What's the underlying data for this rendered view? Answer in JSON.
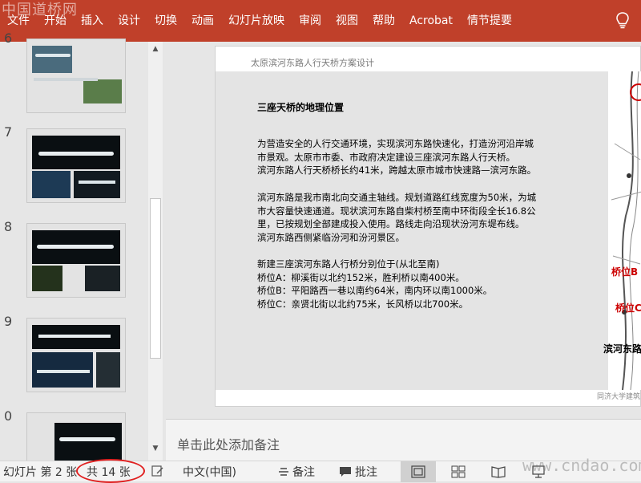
{
  "watermark_top": "中国道桥网",
  "watermark_bottom": "www.cndao.com",
  "ribbon": {
    "tabs": [
      "文件",
      "开始",
      "插入",
      "设计",
      "切换",
      "动画",
      "幻灯片放映",
      "审阅",
      "视图",
      "帮助",
      "Acrobat",
      "情节提要"
    ],
    "tell_me_icon": "lightbulb-icon"
  },
  "thumbnails": {
    "numbers": [
      "6",
      "7",
      "8",
      "9",
      "0"
    ]
  },
  "slide": {
    "header": "太原滨河东路人行天桥方案设计",
    "title": "三座天桥的地理位置",
    "para1": [
      "为营造安全的人行交通环境，实现滨河东路快速化，打造汾河沿岸城",
      "市景观。太原市市委、市政府决定建设三座滨河东路人行天桥。",
      "滨河东路人行天桥桥长约41米，跨越太原市城市快速路—滨河东路。"
    ],
    "para2": [
      "滨河东路是我市南北向交通主轴线。规划道路红线宽度为50米，为城",
      "市大容量快速通道。现状滨河东路自柴村桥至南中环街段全长16.8公",
      "里，已按规划全部建成投入使用。路线走向沿现状汾河东堤布线。",
      "滨河东路西侧紧临汾河和汾河景区。"
    ],
    "para3": [
      "新建三座滨河东路人行桥分别位于(从北至南)",
      "桥位A：柳溪街以北约152米，胜利桥以南400米。",
      "桥位B：平阳路西一巷以南约64米，南内环以南1000米。",
      "桥位C：亲贤北街以北约75米，长风桥以北700米。"
    ],
    "map_labels": [
      "桥位B",
      "桥位C",
      "滨河东路"
    ],
    "footer": "同济大学建筑"
  },
  "notes_placeholder": "单击此处添加备注",
  "status": {
    "slide_info": "幻灯片 第 2 张",
    "total": "共 14 张",
    "language": "中文(中国)",
    "notes_label": "备注",
    "comments_label": "批注"
  },
  "colors": {
    "ribbon": "#c0402a",
    "highlight_circle": "#e02020",
    "map_label_red": "#cc0000"
  }
}
